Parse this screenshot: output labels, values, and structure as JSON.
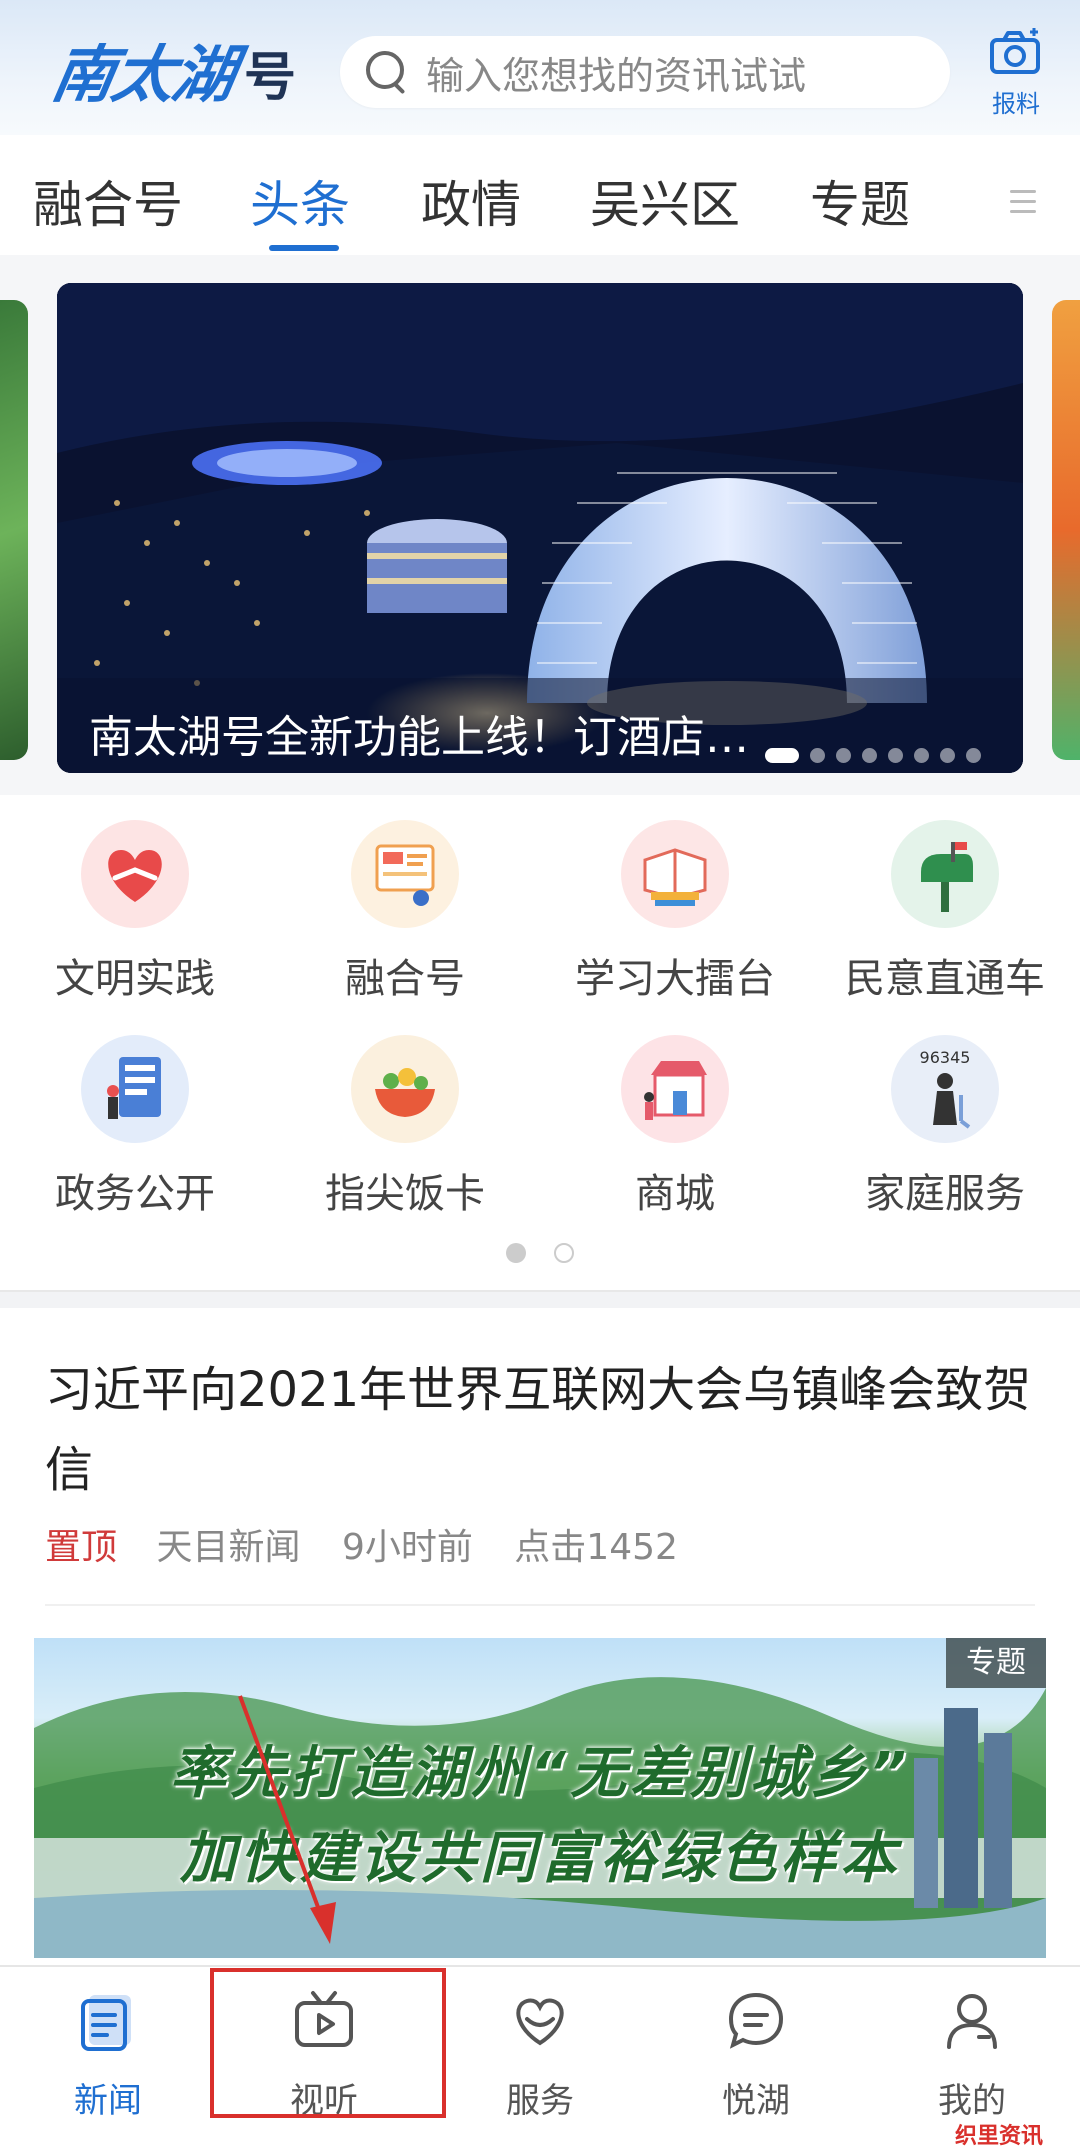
{
  "header": {
    "logo_script": "南太湖",
    "logo_suffix": "号",
    "search_placeholder": "输入您想找的资讯试试",
    "report_label": "报料"
  },
  "tabs": [
    {
      "label": "融合号",
      "active": false
    },
    {
      "label": "头条",
      "active": true
    },
    {
      "label": "政情",
      "active": false
    },
    {
      "label": "吴兴区",
      "active": false
    },
    {
      "label": "专题",
      "active": false
    }
  ],
  "carousel": {
    "caption": "南太湖号全新功能上线！订酒店…",
    "dot_count": 8,
    "active_dot": 0
  },
  "services": [
    {
      "label": "文明实践",
      "icon": "heart-hands-icon"
    },
    {
      "label": "融合号",
      "icon": "media-board-icon"
    },
    {
      "label": "学习大擂台",
      "icon": "books-icon"
    },
    {
      "label": "民意直通车",
      "icon": "mailbox-icon"
    },
    {
      "label": "政务公开",
      "icon": "document-person-icon"
    },
    {
      "label": "指尖饭卡",
      "icon": "food-bowl-icon"
    },
    {
      "label": "商城",
      "icon": "shop-icon"
    },
    {
      "label": "家庭服务",
      "icon": "housekeeper-icon",
      "icon_text": "96345"
    }
  ],
  "grid_pages": {
    "count": 2,
    "active": 0
  },
  "article": {
    "title": "习近平向2021年世界互联网大会乌镇峰会致贺信",
    "pinned": "置顶",
    "source": "天目新闻",
    "time": "9小时前",
    "clicks": "点击1452"
  },
  "special": {
    "badge": "专题",
    "line1": "率先打造湖州“无差别城乡”",
    "line2": "加快建设共同富裕绿色样本"
  },
  "bottom_nav": [
    {
      "label": "新闻",
      "active": true
    },
    {
      "label": "视听",
      "active": false
    },
    {
      "label": "服务",
      "active": false
    },
    {
      "label": "悦湖",
      "active": false
    },
    {
      "label": "我的",
      "active": false
    }
  ],
  "watermark": "织里资讯",
  "colors": {
    "accent": "#1f6fd1",
    "pinned": "#d03a3a",
    "annotation": "#d9302c"
  }
}
